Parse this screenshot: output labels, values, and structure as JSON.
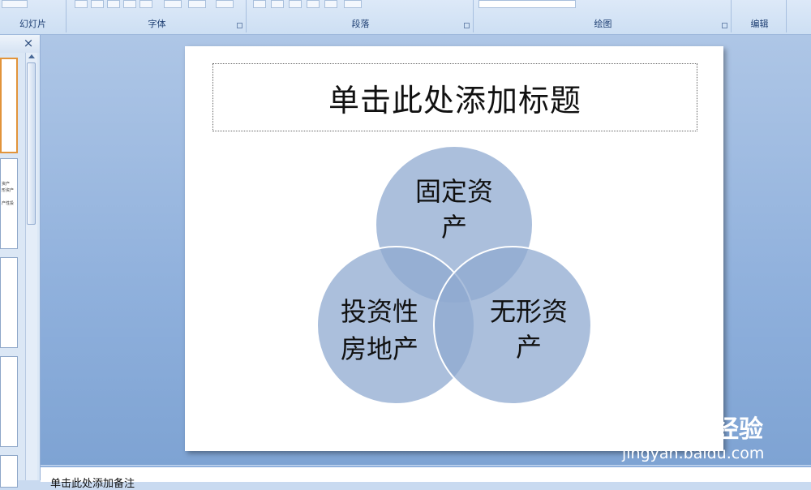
{
  "ribbon": {
    "groups": [
      {
        "label": "幻灯片"
      },
      {
        "label": "字体"
      },
      {
        "label": "段落"
      },
      {
        "label": "绘图"
      },
      {
        "label": "编辑"
      }
    ]
  },
  "slides_panel": {
    "close_label": "×",
    "thumb2_lines": [
      "资产",
      "形资产",
      "产性投"
    ]
  },
  "slide": {
    "title_placeholder": "单击此处添加标题",
    "venn": {
      "circles": [
        {
          "label_line1": "固定资",
          "label_line2": "产"
        },
        {
          "label_line1": "投资性",
          "label_line2": "房地产"
        },
        {
          "label_line1": "无形资",
          "label_line2": "产"
        }
      ],
      "fill_color": "#8fa9d0"
    }
  },
  "notes": {
    "placeholder": "单击此处添加备注"
  },
  "watermark": {
    "brand": "Baidu",
    "product": "经验",
    "url": "jingyan.baidu.com"
  }
}
